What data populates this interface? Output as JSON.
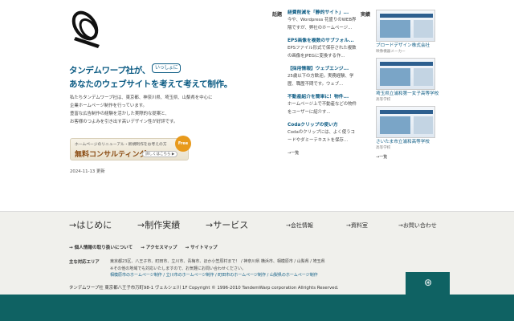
{
  "header": {
    "headline_line1": "タンデムワープ社が、",
    "headline_bubble": "いっしょに",
    "headline_line2": "あなたのウェブサイトを考えて考えて制作。",
    "intro": [
      "私たちタンデムワープ社は、東京都、神奈川県、埼玉県、山梨県を中心に",
      "企業ホームページ制作を行っています。",
      "豊富な広告制作の経験を活かした実際的な提案と、",
      "お客様のつよみを引き出す高いデザイン性が好評です。"
    ],
    "cta_small": "ホームページのリニューアル・新規制作をお考えの方",
    "cta_big": "無料コンサルティング",
    "cta_detail": "詳しくはこちら ▶",
    "cta_circle": "Free",
    "date": "2024-11-13 更新"
  },
  "topics": {
    "label": "話題",
    "items": [
      {
        "title": "経費削減を「静的サイト」...",
        "desc": "今や、Wordpress 花盛りのWEB界隈ですが、弊社のホームページ..."
      },
      {
        "title": "EPS画像を複数のサブフォル...",
        "desc": "EPSファイル形式で保存された複数の画像をJPEGに変換する作..."
      },
      {
        "title": "【採用情報】ウェブエンジ...",
        "desc": "25歳以下の方歓迎。実務経験、学歴、職歴不問です。ウェブ..."
      },
      {
        "title": "不動産紹介を簡単に！物件...",
        "desc": "ホームページ上で不動産などの物件をユーザーに紹介す..."
      },
      {
        "title": "Codaクリップの使い方",
        "desc": "Codaのクリップには、よく使うコードやダミーテキストを保存..."
      }
    ],
    "more": "→一覧"
  },
  "works": {
    "label": "実績",
    "items": [
      {
        "name": "ブロードデザイン株式会社",
        "category": "映像機器メーカー"
      },
      {
        "name": "埼玉県立浦和第一女子高等学校",
        "category": "高等学校"
      },
      {
        "name": "さいたま市立浦和高等学校",
        "category": "高等学校"
      }
    ],
    "more": "→一覧"
  },
  "nav": {
    "main": [
      "→はじめに",
      "→制作実績",
      "→サービス"
    ],
    "sub": [
      "→会社情報",
      "→資料室",
      "→お問い合わせ"
    ],
    "links": [
      "→ 個人情報の取り扱いについて",
      "→ アクセスマップ",
      "→ サイトマップ"
    ],
    "area_label": "主な対応エリア",
    "area_lines": [
      "東京都23区、八王子市、町田市、立川市、青梅市、ほか小笠原村まで！ / 神奈川県 横浜市、相模原市 / 山梨県 / 埼玉県",
      "※その他の地域でも対応いたしますので、お気軽にお問い合わせください。"
    ],
    "area_links": "相模原市のホームページ制作 / 立川市のホームページ制作 / 町田市のホームページ制作 / 山梨県のホームページ制作",
    "copyright": "タンデムワープ社 東京都八王子市万町98-1 ヴェルシェ川 1F Copyright © 1996-2010 TandemWarp corporation Allrights Reserved."
  }
}
